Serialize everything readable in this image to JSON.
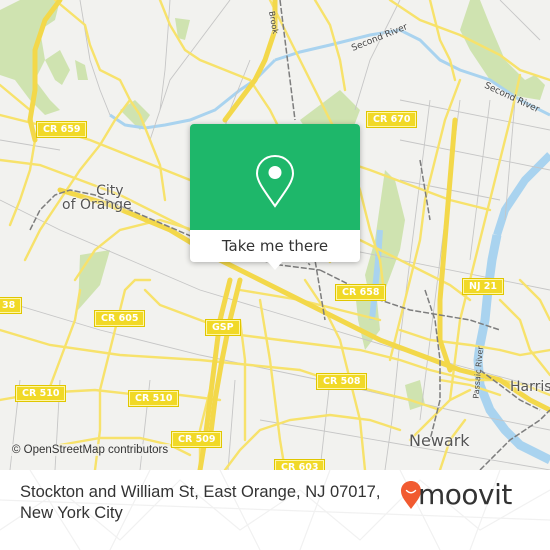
{
  "map": {
    "background_color": "#f2f2ef",
    "road_color": "#f7e26b",
    "water_color": "#a9d3ef",
    "park_color": "#cfe3b0",
    "attribution": "© OpenStreetMap contributors",
    "place_labels": [
      {
        "name": "city-of-orange",
        "text_line1": "City",
        "text_line2": "of Orange"
      },
      {
        "name": "newark",
        "text": "Newark"
      },
      {
        "name": "harrison",
        "text": "Harrison"
      }
    ],
    "river_labels": [
      {
        "name": "second-river-west",
        "text": "Second River"
      },
      {
        "name": "second-river-east",
        "text": "Second River"
      },
      {
        "name": "passaic-river",
        "text": "Passaic River"
      },
      {
        "name": "brook",
        "text": "Brook"
      }
    ],
    "road_shields": [
      {
        "name": "cr-659",
        "text": "CR 659"
      },
      {
        "name": "cr-670",
        "text": "CR 670"
      },
      {
        "name": "cr-658",
        "text": "CR 658"
      },
      {
        "name": "nj-21",
        "text": "NJ 21"
      },
      {
        "name": "cr-638",
        "text": "38"
      },
      {
        "name": "cr-605",
        "text": "CR 605"
      },
      {
        "name": "gsp",
        "text": "GSP"
      },
      {
        "name": "cr-510-west",
        "text": "CR 510"
      },
      {
        "name": "cr-510-east",
        "text": "CR 510"
      },
      {
        "name": "cr-508",
        "text": "CR 508"
      },
      {
        "name": "cr-509",
        "text": "CR 509"
      },
      {
        "name": "cr-603",
        "text": "CR 603"
      }
    ]
  },
  "popup": {
    "button_label": "Take me there",
    "accent_color": "#1eb76a",
    "icon": "map-pin-icon"
  },
  "footer": {
    "address_line1": "Stockton and William St, East Orange, NJ 07017,",
    "address_line2": "New York City",
    "logo_text": "moovit",
    "logo_color": "#f15a30"
  }
}
